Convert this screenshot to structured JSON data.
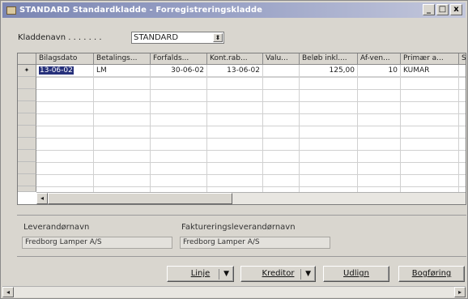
{
  "window": {
    "title": "STANDARD Standardkladde - Forregistreringskladde",
    "minimize": "_",
    "maximize": "□",
    "close": "x"
  },
  "kladde": {
    "label": "Kladdenavn . . . . . . .",
    "value": "STANDARD",
    "arrow": "⬍"
  },
  "grid": {
    "columns": [
      "Bilagsdato",
      "Betalings...",
      "Forfalds...",
      "Kont.rab...",
      "Valu...",
      "Beløb inkl....",
      "Af-ven...",
      "Primær a...",
      "S"
    ],
    "rows": [
      {
        "indicator": "✦",
        "cells": [
          "13-06-02",
          "LM",
          "30-06-02",
          "13-06-02",
          "",
          "125,00",
          "10",
          "KUMAR",
          ""
        ]
      }
    ],
    "scroll_left": "◂"
  },
  "info": {
    "leverandor_label": "Leverandørnavn",
    "leverandor_value": "Fredborg Lamper A/S",
    "faktura_label": "Faktureringsleverandørnavn",
    "faktura_value": "Fredborg Lamper A/S"
  },
  "buttons": {
    "linje": "Linje",
    "kreditor": "Kreditor",
    "udlign": "Udlign",
    "bogfoering": "Bogføring",
    "dropdown_arrow": "▼"
  },
  "window_scroll": {
    "left": "◂",
    "right": "▸"
  }
}
